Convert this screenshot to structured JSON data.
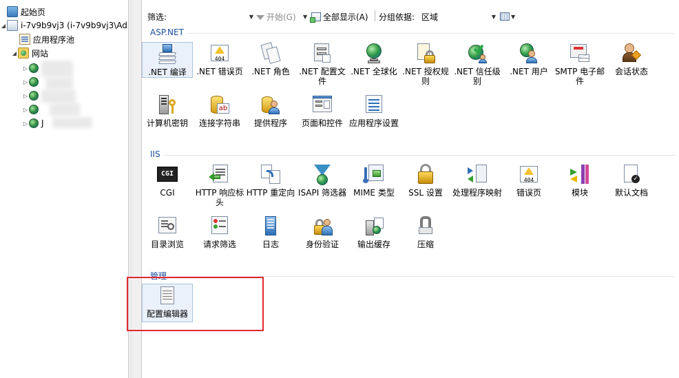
{
  "tree": {
    "items": [
      {
        "label": "起始页",
        "icon": "home-icon"
      },
      {
        "label": "i-7v9b9vj3 (i-7v9b9vj3\\Adm",
        "icon": "server-icon"
      },
      {
        "label": "应用程序池",
        "icon": "app-pool-icon"
      },
      {
        "label": "网站",
        "icon": "sites-folder-icon"
      },
      {
        "label": "",
        "icon": "globe-icon"
      },
      {
        "label": "",
        "icon": "globe-icon"
      },
      {
        "label": "",
        "icon": "globe-icon"
      },
      {
        "label": "",
        "icon": "globe-icon"
      },
      {
        "label": "J",
        "icon": "globe-icon"
      }
    ]
  },
  "toolbar": {
    "filter_label": "筛选:",
    "start_label": "开始(G)",
    "show_all_label": "全部显示(A)",
    "group_by_label": "分组依据:",
    "group_by_value": "区域"
  },
  "groups": [
    {
      "title": "ASP.NET",
      "features": [
        {
          "label": ".NET 编译",
          "icon": "net-compilation-icon"
        },
        {
          "label": ".NET 错误页",
          "icon": "net-error-pages-icon"
        },
        {
          "label": ".NET 角色",
          "icon": "net-roles-icon"
        },
        {
          "label": ".NET 配置文件",
          "icon": "net-profile-icon"
        },
        {
          "label": ".NET 全球化",
          "icon": "net-globalization-icon"
        },
        {
          "label": ".NET 授权规则",
          "icon": "net-authorization-icon"
        },
        {
          "label": ".NET 信任级别",
          "icon": "net-trust-levels-icon"
        },
        {
          "label": ".NET 用户",
          "icon": "net-users-icon"
        },
        {
          "label": "SMTP 电子邮件",
          "icon": "smtp-email-icon"
        },
        {
          "label": "会话状态",
          "icon": "session-state-icon"
        },
        {
          "label": "计算机密钥",
          "icon": "machine-key-icon"
        },
        {
          "label": "连接字符串",
          "icon": "connection-strings-icon"
        },
        {
          "label": "提供程序",
          "icon": "providers-icon"
        },
        {
          "label": "页面和控件",
          "icon": "pages-controls-icon"
        },
        {
          "label": "应用程序设置",
          "icon": "app-settings-icon"
        }
      ]
    },
    {
      "title": "IIS",
      "features": [
        {
          "label": "CGI",
          "icon": "cgi-icon"
        },
        {
          "label": "HTTP 响应标头",
          "icon": "http-response-headers-icon"
        },
        {
          "label": "HTTP 重定向",
          "icon": "http-redirect-icon"
        },
        {
          "label": "ISAPI 筛选器",
          "icon": "isapi-filters-icon"
        },
        {
          "label": "MIME 类型",
          "icon": "mime-types-icon"
        },
        {
          "label": "SSL 设置",
          "icon": "ssl-settings-icon"
        },
        {
          "label": "处理程序映射",
          "icon": "handler-mappings-icon"
        },
        {
          "label": "错误页",
          "icon": "error-pages-icon"
        },
        {
          "label": "模块",
          "icon": "modules-icon"
        },
        {
          "label": "默认文档",
          "icon": "default-document-icon"
        },
        {
          "label": "目录浏览",
          "icon": "directory-browsing-icon"
        },
        {
          "label": "请求筛选",
          "icon": "request-filtering-icon"
        },
        {
          "label": "日志",
          "icon": "logging-icon"
        },
        {
          "label": "身份验证",
          "icon": "authentication-icon"
        },
        {
          "label": "输出缓存",
          "icon": "output-caching-icon"
        },
        {
          "label": "压缩",
          "icon": "compression-icon"
        }
      ]
    },
    {
      "title": "管理",
      "features": [
        {
          "label": "配置编辑器",
          "icon": "configuration-editor-icon"
        }
      ]
    }
  ],
  "cgi_icon_text": "CGI",
  "error_code_text": "404",
  "connection_icon_text": "ab",
  "colors": {
    "group_header": "#1c4e9c",
    "selection_bg": "#eaf1fa",
    "highlight_box": "#e0282e"
  }
}
